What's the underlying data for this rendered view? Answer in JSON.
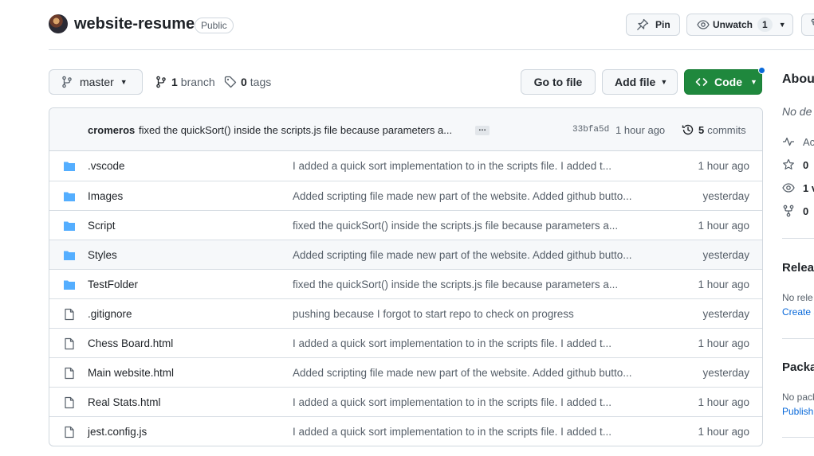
{
  "repo": {
    "name": "website-resume",
    "visibility": "Public"
  },
  "header_actions": {
    "pin_label": "Pin",
    "watch_label": "Unwatch",
    "watch_count": "1"
  },
  "toolbar": {
    "branch_name": "master",
    "branch_count": "1",
    "branch_label": "branch",
    "tag_count": "0",
    "tag_label": "tags",
    "goto_file": "Go to file",
    "add_file": "Add file",
    "code": "Code"
  },
  "latest_commit": {
    "author": "cromeros",
    "message": "fixed the quickSort() inside the scripts.js file because parameters a...",
    "ellipsis": "…",
    "sha": "33bfa5d",
    "time": "1 hour ago",
    "commit_count": "5",
    "commit_label": "commits"
  },
  "files": [
    {
      "type": "folder",
      "name": ".vscode",
      "message": "I added a quick sort implementation to in the scripts file. I added t...",
      "time": "1 hour ago"
    },
    {
      "type": "folder",
      "name": "Images",
      "message": "Added scripting file made new part of the website. Added github butto...",
      "time": "yesterday"
    },
    {
      "type": "folder",
      "name": "Script",
      "message": "fixed the quickSort() inside the scripts.js file because parameters a...",
      "time": "1 hour ago"
    },
    {
      "type": "folder",
      "name": "Styles",
      "message": "Added scripting file made new part of the website. Added github butto...",
      "time": "yesterday"
    },
    {
      "type": "folder",
      "name": "TestFolder",
      "message": "fixed the quickSort() inside the scripts.js file because parameters a...",
      "time": "1 hour ago"
    },
    {
      "type": "file",
      "name": ".gitignore",
      "message": "pushing because I forgot to start repo to check on progress",
      "time": "yesterday"
    },
    {
      "type": "file",
      "name": "Chess Board.html",
      "message": "I added a quick sort implementation to in the scripts file. I added t...",
      "time": "1 hour ago"
    },
    {
      "type": "file",
      "name": "Main website.html",
      "message": "Added scripting file made new part of the website. Added github butto...",
      "time": "yesterday"
    },
    {
      "type": "file",
      "name": "Real Stats.html",
      "message": "I added a quick sort implementation to in the scripts file. I added t...",
      "time": "1 hour ago"
    },
    {
      "type": "file",
      "name": "jest.config.js",
      "message": "I added a quick sort implementation to in the scripts file. I added t...",
      "time": "1 hour ago"
    }
  ],
  "sidebar": {
    "about_title": "Abou",
    "about_desc": "No de",
    "activity_label": "Ac",
    "stars_count": "0",
    "watchers_count": "1 v",
    "forks_count": "0",
    "releases_title": "Relea",
    "releases_text": "No rele",
    "releases_link": "Create a",
    "packages_title": "Packa",
    "packages_text": "No pack",
    "packages_link": "Publish"
  },
  "icons": {
    "avatar": "avatar-image",
    "pin": "pin-icon",
    "watch": "eye-icon",
    "fork": "fork-icon",
    "branch": "git-branch-icon",
    "tag": "tag-icon",
    "code": "code-icon",
    "history": "history-icon",
    "folder": "folder-icon",
    "file": "file-icon",
    "activity": "pulse-icon",
    "star": "star-icon"
  },
  "colors": {
    "accent_green": "#1f883d",
    "folder_blue": "#54aeff",
    "link_blue": "#0969da",
    "muted_text": "#57606a"
  }
}
